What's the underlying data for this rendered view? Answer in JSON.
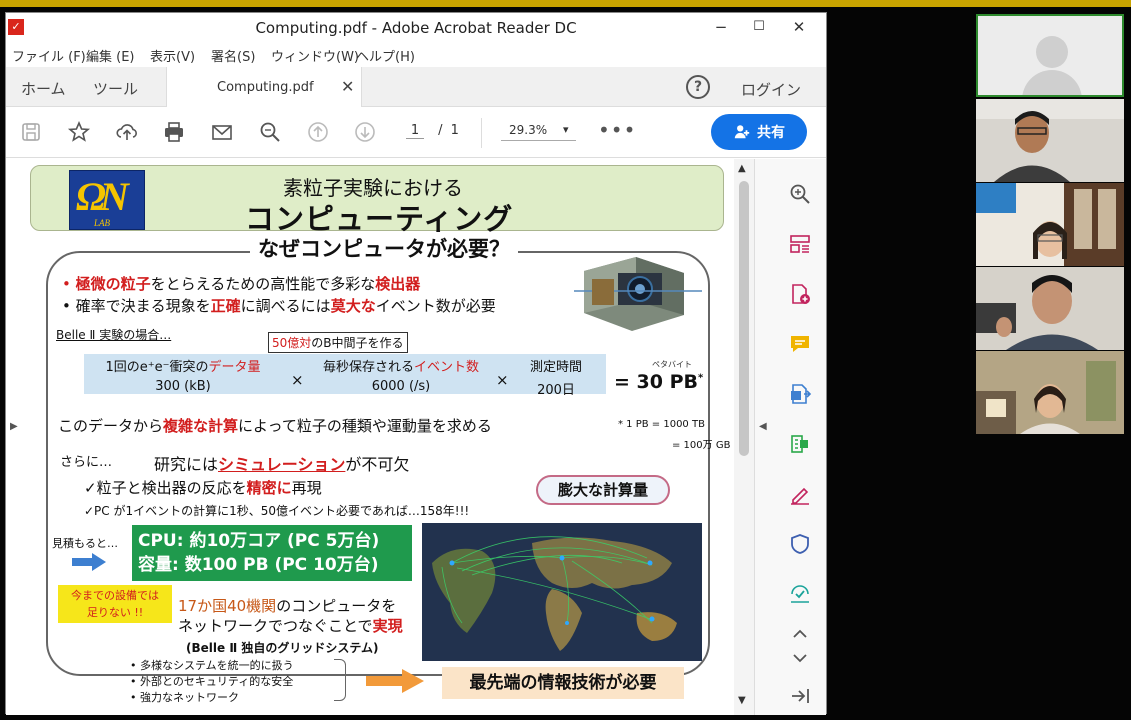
{
  "window": {
    "title": "Computing.pdf - Adobe Acrobat Reader DC",
    "minimize": "−",
    "maximize": "☐",
    "close": "✕"
  },
  "menu": [
    "ファイル (F)",
    "編集 (E)",
    "表示(V)",
    "署名(S)",
    "ウィンドウ(W)",
    "ヘルプ(H)"
  ],
  "tabs": {
    "home": "ホーム",
    "tools": "ツール",
    "doc": "Computing.pdf",
    "close": "✕",
    "help": "?",
    "login": "ログイン"
  },
  "toolbar": {
    "page_current": "1",
    "page_sep": "/",
    "page_total": "1",
    "zoom": "29.3%",
    "zoom_caret": "▾",
    "more": "•••",
    "share": "共有"
  },
  "slide": {
    "title_line1": "素粒子実験における",
    "title_line2": "コンピューティング",
    "logo_lab": "LAB",
    "section_title": "なぜコンピュータが必要？",
    "bullet1": {
      "dot": "•",
      "red1": "極微の粒子",
      "mid": "をとらえるための高性能で多彩な",
      "red2": "検出器"
    },
    "bullet2": {
      "dot": "•",
      "a": "確率で決まる現象を",
      "red1": "正確",
      "b": "に調べるには",
      "red2": "莫大な",
      "c": "イベント数が必要"
    },
    "belle_case": "Belle Ⅱ 実験の場合…",
    "event_box": {
      "red": "50億対",
      "rest": "のB中間子を作る"
    },
    "calc": {
      "c1_a": "1回のe⁺e⁻衝突の",
      "c1_red": "データ量",
      "c1_val": "300 (kB)",
      "times": "×",
      "c2_a": "毎秒保存される",
      "c2_red": "イベント数",
      "c2_val": "6000 (/s)",
      "c3_a": "測定時間",
      "c3_val": "200日",
      "result": "= 30 PB",
      "result_star": "*",
      "ruby": "ペタバイト"
    },
    "footnote1": "* 1 PB = 1000 TB",
    "footnote2": "= 100万 GB",
    "line2": {
      "a": "このデータから",
      "red": "複雑な計算",
      "b": "によって粒子の種類や運動量を求める"
    },
    "furthermore": "さらに…",
    "sim": {
      "a": "研究には",
      "red": "シミュレーション",
      "b": "が不可欠"
    },
    "check1": {
      "mark": "✓",
      "a": "粒子と検出器の反応を",
      "red": "精密に",
      "b": "再現"
    },
    "check2": "✓PC が1イベントの計算に1秒、50億イベント必要であれば…158年!!!",
    "huge_badge": "膨大な計算量",
    "estimate_label": "見積もると…",
    "cpu_line": "CPU: 約10万コア  (PC  5万台)",
    "storage_line": "容量: 数100 PB  (PC  10万台)",
    "not_enough_1": "今までの設備では",
    "not_enough_2": "足りない !!",
    "network": {
      "orange": "17か国40機関",
      "a": "のコンピュータを",
      "b": "ネットワークでつなぐことで",
      "red": "実現",
      "c": "(Belle Ⅱ 独自のグリッドシステム)"
    },
    "sub_bullets": [
      "多様なシステムを統一的に扱う",
      "外部とのセキュリティ的な安全",
      "強力なネットワーク"
    ],
    "sub_dot": "•",
    "cutting_edge": "最先端の情報技術が必要"
  },
  "colors": {
    "accent_blue": "#1473e6",
    "right_tool_icons": "#c2245e",
    "header_green": "#dfedc8",
    "cpu_green": "#1f9a4d",
    "text_red": "#d21e1e"
  },
  "participants": [
    "participant-avatar-placeholder",
    "participant-video-1",
    "participant-video-2",
    "participant-video-3",
    "participant-video-4"
  ]
}
